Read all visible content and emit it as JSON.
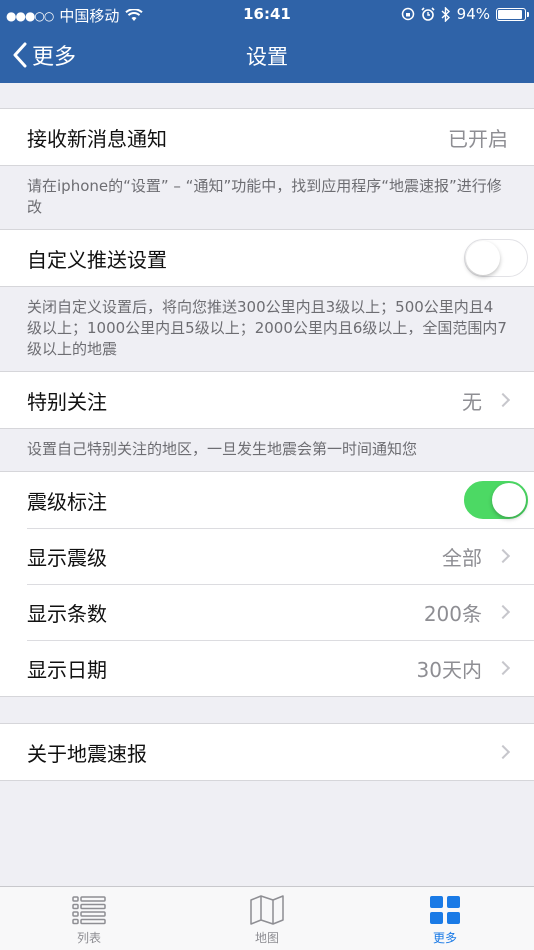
{
  "status_bar": {
    "signal": "●●●○○",
    "carrier": "中国移动",
    "time": "16:41",
    "battery_text": "94%",
    "battery_level": 0.94
  },
  "nav": {
    "back_label": "更多",
    "title": "设置"
  },
  "notify": {
    "label": "接收新消息通知",
    "value": "已开启",
    "note": "请在iphone的“设置” – “通知”功能中，找到应用程序“地震速报”进行修改"
  },
  "custom_push": {
    "label": "自定义推送设置",
    "on": false,
    "note": "关闭自定义设置后，将向您推送300公里内且3级以上；500公里内且4级以上；1000公里内且5级以上；2000公里内且6级以上，全国范围内7级以上的地震"
  },
  "special": {
    "label": "特别关注",
    "value": "无",
    "note": "设置自己特别关注的地区，一旦发生地震会第一时间通知您"
  },
  "display": {
    "magnitude_label": {
      "label": "震级标注",
      "on": true
    },
    "show_magnitude": {
      "label": "显示震级",
      "value": "全部"
    },
    "show_count": {
      "label": "显示条数",
      "value": "200条"
    },
    "show_date": {
      "label": "显示日期",
      "value": "30天内"
    }
  },
  "about": {
    "label": "关于地震速报"
  },
  "tabs": [
    {
      "label": "列表",
      "icon": "list-icon"
    },
    {
      "label": "地图",
      "icon": "map-icon"
    },
    {
      "label": "更多",
      "icon": "grid-icon"
    }
  ],
  "colors": {
    "nav": "#2f63a8",
    "toggle_on": "#4cd964",
    "tab_active": "#1a7ae6"
  }
}
